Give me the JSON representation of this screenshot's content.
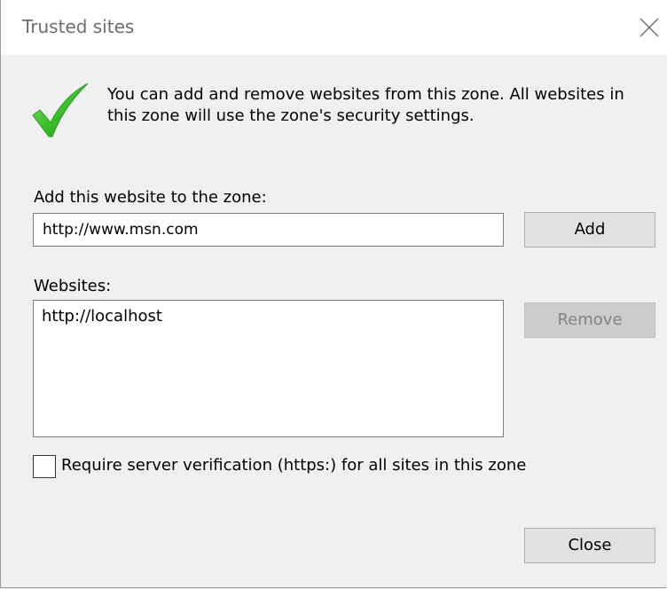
{
  "window": {
    "title": "Trusted sites"
  },
  "info": {
    "line1": "You can add and remove websites from this zone. All websites in",
    "line2": "this zone will use the zone's security settings."
  },
  "add_section": {
    "label": "Add this website to the zone:",
    "input_value": "http://www.msn.com",
    "add_button": "Add"
  },
  "websites_section": {
    "label": "Websites:",
    "items": [
      "http://localhost"
    ],
    "remove_button": "Remove",
    "remove_disabled": true
  },
  "verification": {
    "label": "Require server verification (https:) for all sites in this zone",
    "checked": false
  },
  "footer": {
    "close_button": "Close"
  },
  "colors": {
    "checkmark_green": "#3cbf2e",
    "button_face": "#e1e1e1",
    "button_disabled": "#cccccc",
    "dialog_bg": "#f0f0f0"
  },
  "icons": {
    "title_close": "close-icon",
    "info": "checkmark-icon"
  }
}
